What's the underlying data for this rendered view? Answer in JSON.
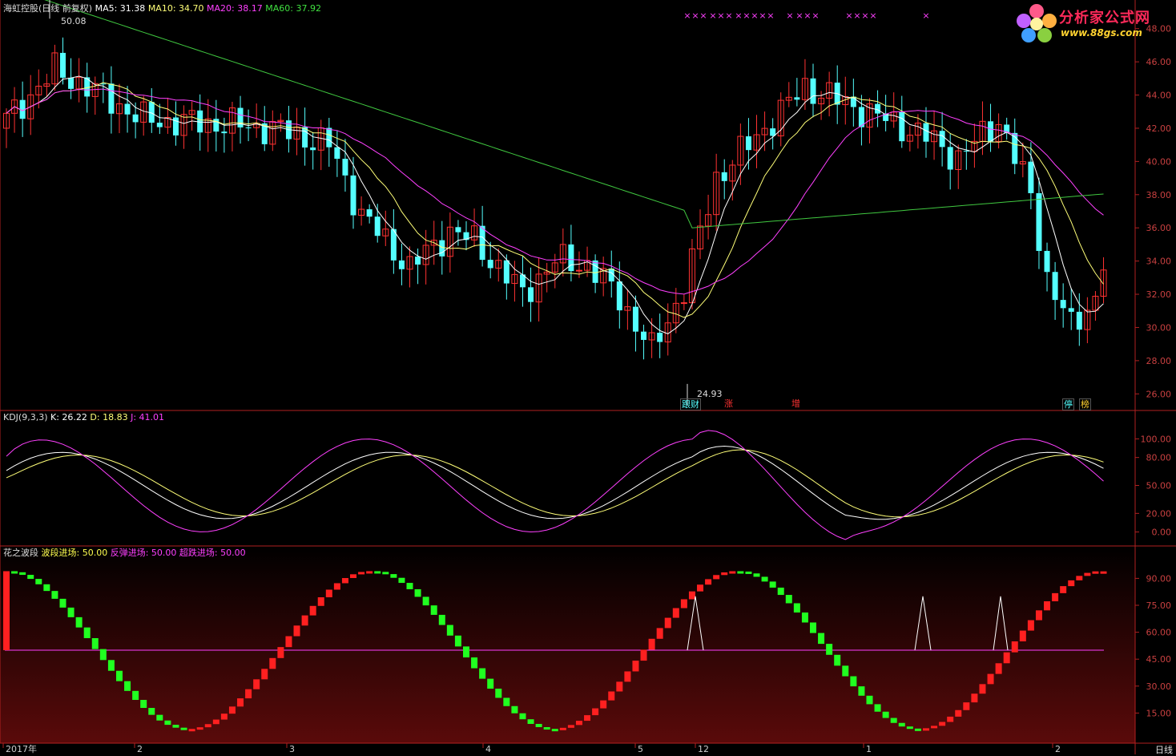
{
  "header": {
    "title": "海虹控股(日线 前复权)",
    "ma5": "MA5: 31.38",
    "ma10": "MA10: 34.70",
    "ma20": "MA20: 38.17",
    "ma60": "MA60: 37.92"
  },
  "kdj": {
    "title": "KDJ(9,3,3)",
    "k": "K: 26.22",
    "d": "D: 18.83",
    "j": "J: 41.01"
  },
  "flower": {
    "title": "花之波段",
    "wave": "波段进场: 50.00",
    "rebound": "反弹进场: 50.00",
    "oversold": "超跌进场: 50.00"
  },
  "annotations": {
    "high": "50.08",
    "low": "24.93"
  },
  "badges": [
    "跟财",
    "涨",
    "增",
    "停",
    "榜"
  ],
  "logo": {
    "text": "分析家公式网",
    "url": "www.88gs.com"
  },
  "axes": {
    "price_ticks": [
      "48.00",
      "46.00",
      "44.00",
      "42.00",
      "40.00",
      "38.00",
      "36.00",
      "34.00",
      "32.00",
      "30.00",
      "28.00",
      "26.00"
    ],
    "kdj_ticks": [
      "100.00",
      "80.00",
      "50.00",
      "20.00",
      "0.00"
    ],
    "flower_ticks": [
      "90.00",
      "75.00",
      "60.00",
      "45.00",
      "30.00",
      "15.00"
    ],
    "x_labels": [
      "2017年",
      "2",
      "3",
      "4",
      "5",
      "12",
      "1",
      "2"
    ],
    "period": "日线"
  },
  "colors": {
    "up": "#ff3232",
    "down": "#54ffff",
    "ma5": "#ffffff",
    "ma10": "#ffff78",
    "ma20": "#ff40ff",
    "ma60": "#40c840",
    "axis": "#b02020",
    "flower_up": "#ff2020",
    "flower_down": "#20ff20"
  }
}
